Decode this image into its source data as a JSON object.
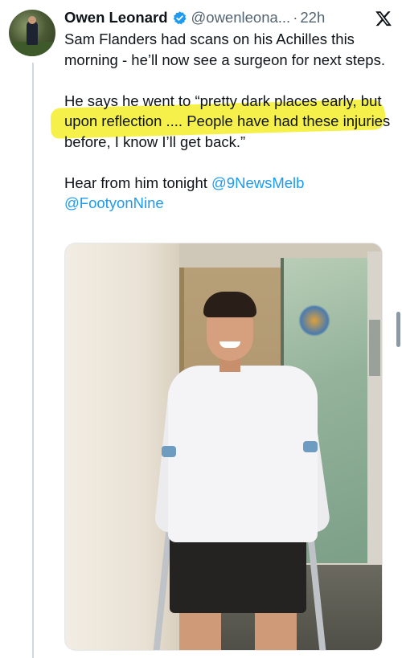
{
  "tweet": {
    "author_name": "Owen Leonard",
    "author_handle": "@owenleona...",
    "separator": "·",
    "time": "22h",
    "verified": true,
    "text_p1": "Sam Flanders had scans on his Achilles this morning - he’ll now see a surgeon for next steps.",
    "text_p2": "He says he went to “pretty dark places early, but upon reflection .... People have had these injuries before, I know I’ll get back.”",
    "text_p3_prefix": "Hear from him tonight",
    "mention_1": "@9NewsMelb",
    "mention_2": "@FootyonNine"
  },
  "icons": {
    "verified": "verified-badge-icon",
    "platform": "x-logo-icon"
  },
  "colors": {
    "link": "#1d9bf0",
    "verified": "#1d9bf0",
    "secondary_text": "#536471",
    "highlight": "#f6f14a"
  }
}
